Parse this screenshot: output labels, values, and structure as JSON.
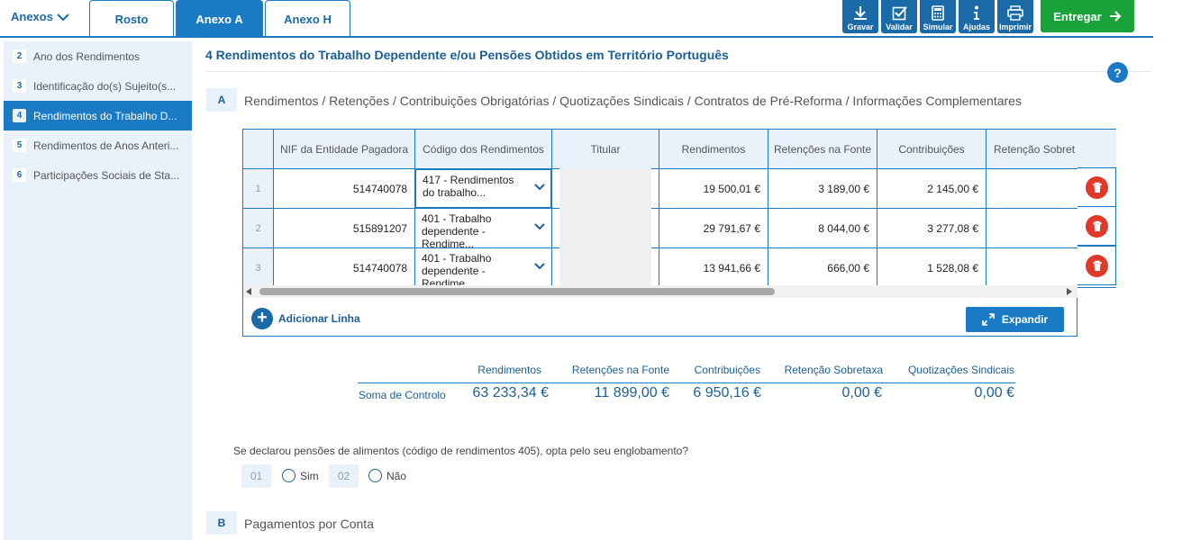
{
  "topbar": {
    "anexos_label": "Anexos",
    "tabs": [
      {
        "label": "Rosto"
      },
      {
        "label": "Anexo A"
      },
      {
        "label": "Anexo H"
      }
    ],
    "tools": [
      {
        "label": "Gravar",
        "icon": "download-icon"
      },
      {
        "label": "Validar",
        "icon": "checkbox-icon"
      },
      {
        "label": "Simular",
        "icon": "calculator-icon"
      },
      {
        "label": "Ajudas",
        "icon": "info-icon"
      },
      {
        "label": "Imprimir",
        "icon": "printer-icon"
      }
    ],
    "submit_label": "Entregar"
  },
  "sidebar": {
    "items": [
      {
        "num": "2",
        "label": "Ano dos Rendimentos"
      },
      {
        "num": "3",
        "label": "Identificação do(s) Sujeito(s..."
      },
      {
        "num": "4",
        "label": "Rendimentos do Trabalho D..."
      },
      {
        "num": "5",
        "label": "Rendimentos de Anos Anteri..."
      },
      {
        "num": "6",
        "label": "Participações Sociais de Sta..."
      }
    ]
  },
  "main": {
    "section_title": "4  Rendimentos do Trabalho Dependente e/ou Pensões Obtidos em Território Português",
    "help_label": "?",
    "quadro_a": {
      "letter": "A",
      "title": "Rendimentos / Retenções / Contribuições Obrigatórias / Quotizações Sindicais / Contratos de Pré-Reforma / Informações Complementares"
    },
    "table": {
      "headers": [
        "NIF da Entidade Pagadora",
        "Código dos Rendimentos",
        "Titular",
        "Rendimentos",
        "Retenções na Fonte",
        "Contribuições",
        "Retenção Sobret"
      ],
      "rows": [
        {
          "n": "1",
          "nif": "514740078",
          "code": "417 - Rendimentos do trabalho...",
          "rend": "19 500,01 €",
          "ret": "3 189,00 €",
          "contr": "2 145,00 €"
        },
        {
          "n": "2",
          "nif": "515891207",
          "code": "401 - Trabalho dependente - Rendime...",
          "rend": "29 791,67 €",
          "ret": "8 044,00 €",
          "contr": "3 277,08 €"
        },
        {
          "n": "3",
          "nif": "514740078",
          "code": "401 - Trabalho dependente - Rendime...",
          "rend": "13 941,66 €",
          "ret": "666,00 €",
          "contr": "1 528,08 €"
        }
      ]
    },
    "add_line_label": "Adicionar Linha",
    "expand_label": "Expandir",
    "totals": {
      "headers": [
        "Rendimentos",
        "Retenções na Fonte",
        "Contribuições",
        "Retenção Sobretaxa",
        "Quotizações Sindicais"
      ],
      "label": "Soma de Controlo",
      "values": [
        "63 233,34 €",
        "11 899,00 €",
        "6 950,16 €",
        "0,00 €",
        "0,00 €"
      ]
    },
    "pension_question": {
      "text": "Se declarou pensões de alimentos (código de rendimentos 405), opta pelo seu englobamento?",
      "options": [
        {
          "code": "01",
          "label": "Sim"
        },
        {
          "code": "02",
          "label": "Não"
        }
      ]
    },
    "quadro_b": {
      "letter": "B",
      "title": "Pagamentos por Conta"
    }
  },
  "colors": {
    "primary": "#1a7bc4",
    "dark_blue": "#1a5f96",
    "success": "#1aa33a",
    "danger": "#e0392b",
    "light_bg": "#e9f2fa"
  }
}
